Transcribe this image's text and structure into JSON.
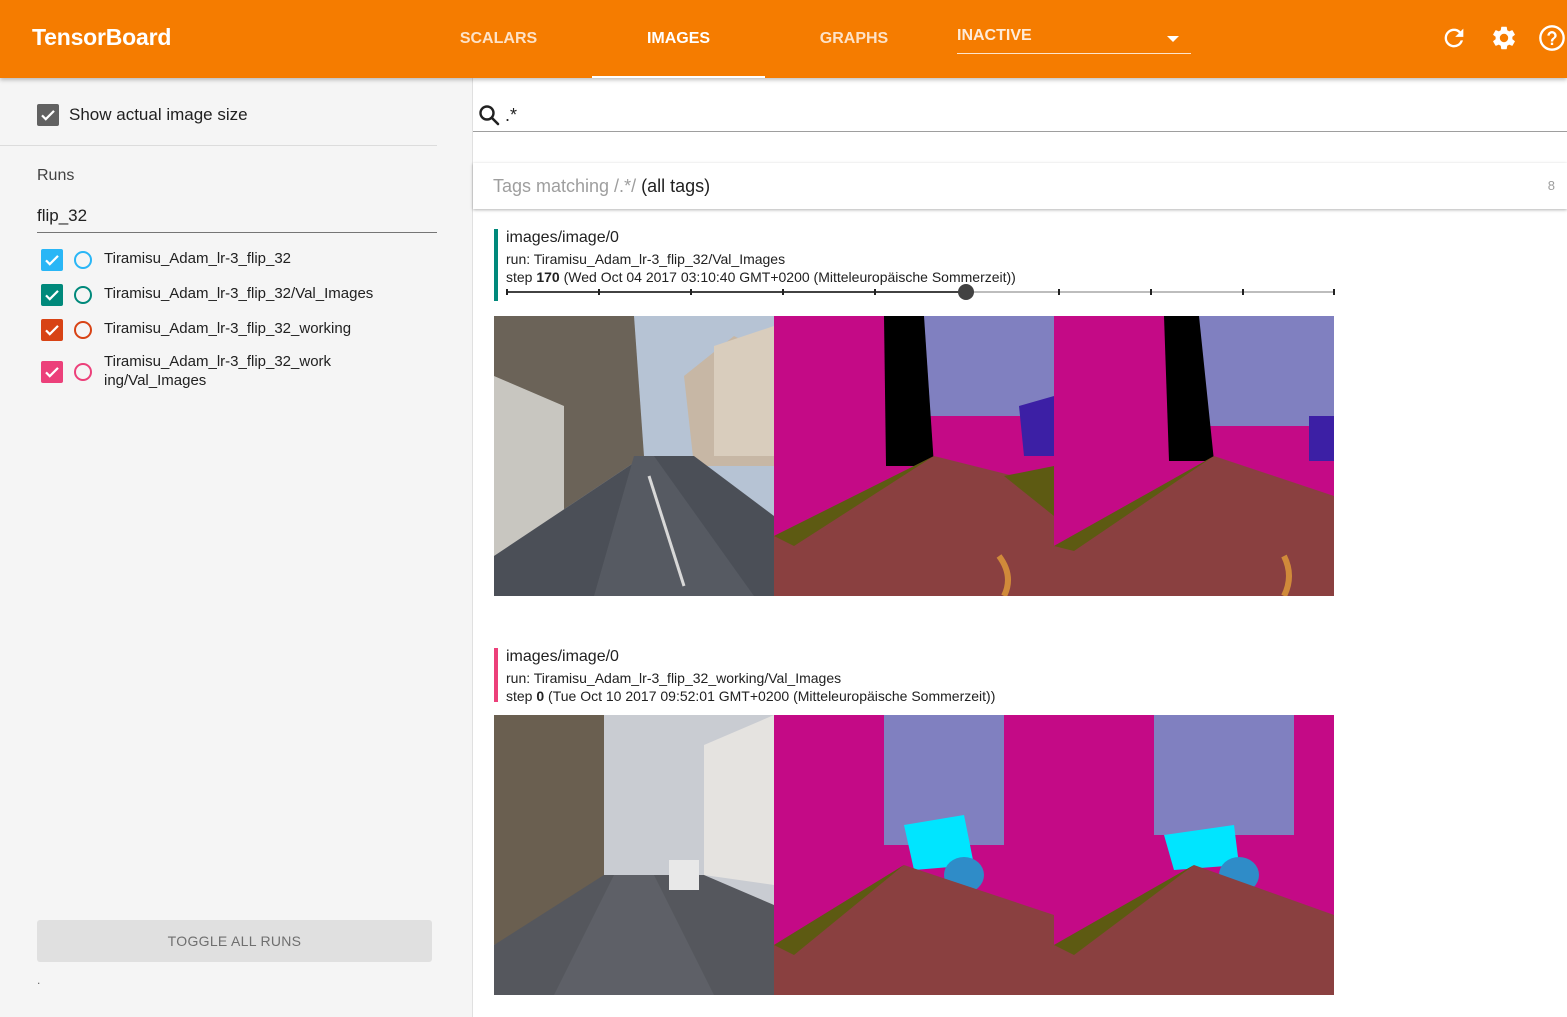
{
  "header": {
    "brand": "TensorBoard",
    "tabs": [
      {
        "label": "SCALARS",
        "active": false
      },
      {
        "label": "IMAGES",
        "active": true
      },
      {
        "label": "GRAPHS",
        "active": false
      }
    ],
    "inactive_label": "INACTIVE",
    "icons": [
      "refresh-icon",
      "settings-icon",
      "help-icon"
    ],
    "accent": "#f57c00"
  },
  "sidebar": {
    "show_actual_size_label": "Show actual image size",
    "show_actual_size_checked": true,
    "runs_title": "Runs",
    "runs_filter": "flip_32",
    "runs": [
      {
        "label": "Tiramisu_Adam_lr-3_flip_32",
        "color": "#29b6f6",
        "checked": true
      },
      {
        "label": "Tiramisu_Adam_lr-3_flip_32/Val_Images",
        "color": "#00897b",
        "checked": true
      },
      {
        "label": "Tiramisu_Adam_lr-3_flip_32_working",
        "color": "#d84315",
        "checked": true
      },
      {
        "label": "Tiramisu_Adam_lr-3_flip_32_working/Val_Images",
        "color": "#ec407a",
        "checked": true
      }
    ],
    "toggle_label": "TOGGLE ALL RUNS",
    "footer_dot": "."
  },
  "main": {
    "search_value": ".*",
    "tags_prefix": "Tags matching /.*/",
    "tags_suffix": "(all tags)",
    "tags_count": "8",
    "cards": [
      {
        "tag": "images/image/0",
        "run": "run: Tiramisu_Adam_lr-3_flip_32/Val_Images",
        "step_prefix": "step",
        "step_value": "170",
        "step_time": "(Wed Oct 04 2017 03:10:40 GMT+0200 (Mitteleuropäische Sommerzeit))",
        "color": "#00897b",
        "slider_fraction": 0.55
      },
      {
        "tag": "images/image/0",
        "run": "run: Tiramisu_Adam_lr-3_flip_32_working/Val_Images",
        "step_prefix": "step",
        "step_value": "0",
        "step_time": "(Tue Oct 10 2017 09:52:01 GMT+0200 (Mitteleuropäische Sommerzeit))",
        "color": "#ec407a"
      }
    ]
  }
}
